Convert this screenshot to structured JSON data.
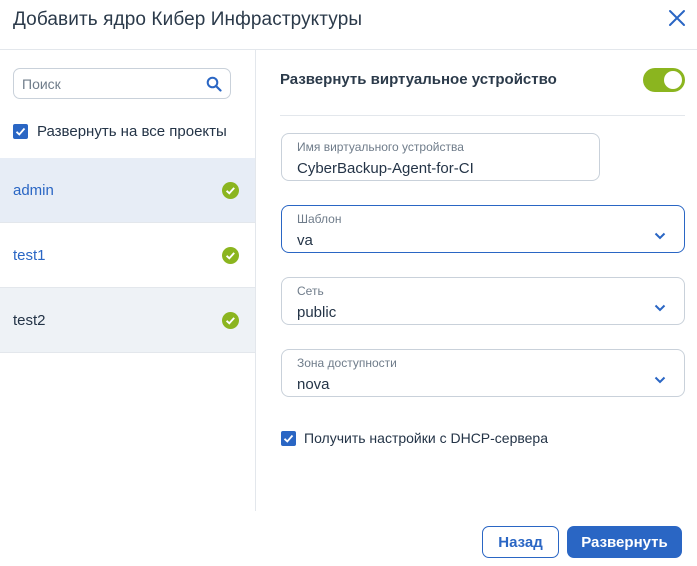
{
  "dialog": {
    "title": "Добавить ядро Кибер Инфраструктуры"
  },
  "left": {
    "search": {
      "placeholder": "Поиск",
      "value": ""
    },
    "deploy_all": {
      "label": "Развернуть на все проекты",
      "checked": true
    },
    "projects": [
      {
        "name": "admin",
        "checked": true
      },
      {
        "name": "test1",
        "checked": true
      },
      {
        "name": "test2",
        "checked": true
      }
    ]
  },
  "right": {
    "deploy_vm": {
      "label": "Развернуть виртуальное устройство",
      "enabled": true
    },
    "fields": {
      "vm_name": {
        "label": "Имя виртуального устройства",
        "value": "CyberBackup-Agent-for-CI"
      },
      "template": {
        "label": "Шаблон",
        "value": "va"
      },
      "network": {
        "label": "Сеть",
        "value": "public"
      },
      "zone": {
        "label": "Зона доступности",
        "value": "nova"
      }
    },
    "dhcp": {
      "label": "Получить настройки с DHCP-сервера",
      "checked": true
    }
  },
  "footer": {
    "back_label": "Назад",
    "deploy_label": "Развернуть"
  },
  "colors": {
    "accent": "#2a66c4",
    "success": "#8bb51f",
    "selected_row": "#e7edf6"
  }
}
